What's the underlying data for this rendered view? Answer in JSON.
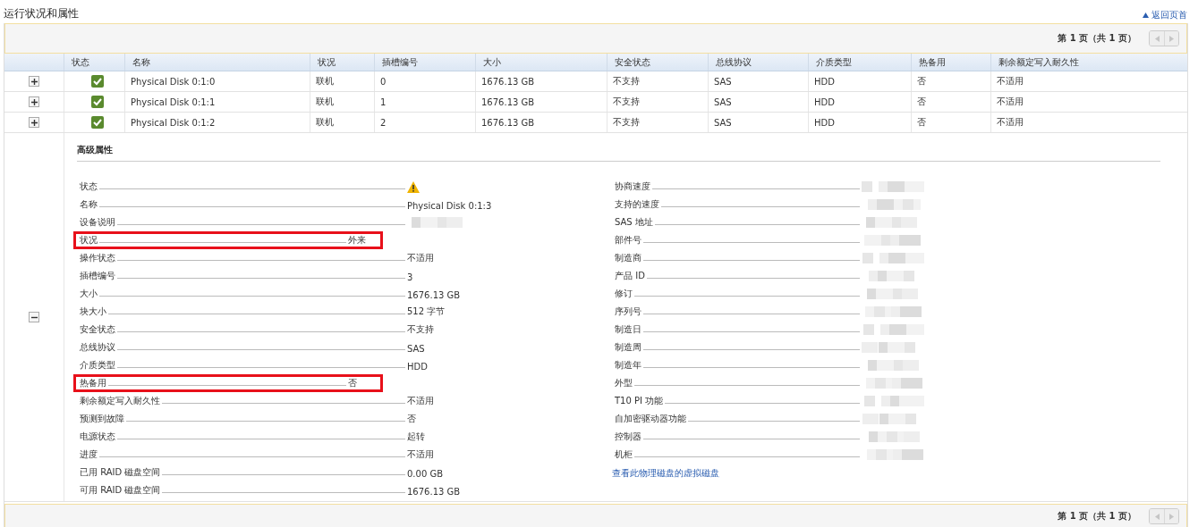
{
  "page_title": "运行状况和属性",
  "back_to_top": {
    "label": "返回页首"
  },
  "pager_top": {
    "label": "第 1 页（共 1 页）",
    "prev_disabled": true,
    "next_disabled": true
  },
  "table": {
    "columns": [
      "状态",
      "名称",
      "状况",
      "插槽编号",
      "大小",
      "安全状态",
      "总线协议",
      "介质类型",
      "热备用",
      "剩余额定写入耐久性"
    ],
    "rows": [
      {
        "expanded": false,
        "warning": false,
        "cells": [
          "Physical Disk 0:1:0",
          "联机",
          "0",
          "1676.13 GB",
          "不支持",
          "SAS",
          "HDD",
          "否",
          "不适用"
        ]
      },
      {
        "expanded": false,
        "warning": false,
        "cells": [
          "Physical Disk 0:1:1",
          "联机",
          "1",
          "1676.13 GB",
          "不支持",
          "SAS",
          "HDD",
          "否",
          "不适用"
        ]
      },
      {
        "expanded": false,
        "warning": false,
        "cells": [
          "Physical Disk 0:1:2",
          "联机",
          "2",
          "1676.13 GB",
          "不支持",
          "SAS",
          "HDD",
          "否",
          "不适用"
        ]
      },
      {
        "expanded": true,
        "details": {
          "title": "高级属性",
          "left": [
            {
              "label": "状态",
              "kind": "status",
              "warning": true,
              "highlighted": false
            },
            {
              "label": "名称",
              "kind": "text",
              "value": "Physical Disk 0:1:3",
              "highlighted": false
            },
            {
              "label": "设备说明",
              "kind": "redacted",
              "highlighted": false
            },
            {
              "label": "状况",
              "kind": "text",
              "value": "外来",
              "highlighted": true
            },
            {
              "label": "操作状态",
              "kind": "text",
              "value": "不适用",
              "highlighted": false
            },
            {
              "label": "插槽编号",
              "kind": "text",
              "value": "3",
              "highlighted": false
            },
            {
              "label": "大小",
              "kind": "text",
              "value": "1676.13 GB",
              "highlighted": false
            },
            {
              "label": "块大小",
              "kind": "text",
              "value": "512 字节",
              "highlighted": false
            },
            {
              "label": "安全状态",
              "kind": "text",
              "value": "不支持",
              "highlighted": false
            },
            {
              "label": "总线协议",
              "kind": "text",
              "value": "SAS",
              "highlighted": false
            },
            {
              "label": "介质类型",
              "kind": "text",
              "value": "HDD",
              "highlighted": false
            },
            {
              "label": "热备用",
              "kind": "text",
              "value": "否",
              "highlighted": true
            },
            {
              "label": "剩余额定写入耐久性",
              "kind": "text",
              "value": "不适用",
              "highlighted": false
            },
            {
              "label": "预测到故障",
              "kind": "text",
              "value": "否",
              "highlighted": false
            },
            {
              "label": "电源状态",
              "kind": "text",
              "value": "起转",
              "highlighted": false
            },
            {
              "label": "进度",
              "kind": "text",
              "value": "不适用",
              "highlighted": false
            },
            {
              "label": "已用 RAID 磁盘空间",
              "kind": "text",
              "value": "0.00 GB",
              "highlighted": false
            },
            {
              "label": "可用 RAID 磁盘空间",
              "kind": "text",
              "value": "1676.13 GB",
              "highlighted": false
            }
          ],
          "right": [
            {
              "label": "协商速度",
              "kind": "redacted",
              "highlighted": false
            },
            {
              "label": "支持的速度",
              "kind": "redacted",
              "highlighted": false
            },
            {
              "label": "SAS 地址",
              "kind": "redacted",
              "highlighted": false
            },
            {
              "label": "部件号",
              "kind": "redacted",
              "highlighted": false
            },
            {
              "label": "制造商",
              "kind": "redacted",
              "highlighted": false
            },
            {
              "label": "产品 ID",
              "kind": "redacted",
              "highlighted": false
            },
            {
              "label": "修订",
              "kind": "redacted",
              "highlighted": false
            },
            {
              "label": "序列号",
              "kind": "redacted",
              "highlighted": false
            },
            {
              "label": "制造日",
              "kind": "redacted",
              "highlighted": false
            },
            {
              "label": "制造周",
              "kind": "redacted",
              "highlighted": false
            },
            {
              "label": "制造年",
              "kind": "redacted",
              "highlighted": false
            },
            {
              "label": "外型",
              "kind": "redacted",
              "highlighted": false
            },
            {
              "label": "T10 PI 功能",
              "kind": "redacted",
              "highlighted": false
            },
            {
              "label": "自加密驱动器功能",
              "kind": "redacted",
              "highlighted": false
            },
            {
              "label": "控制器",
              "kind": "redacted",
              "highlighted": false
            },
            {
              "label": "机柜",
              "kind": "redacted",
              "highlighted": false
            }
          ],
          "link": "查看此物理磁盘的虚拟磁盘"
        }
      }
    ]
  },
  "pager_bottom": {
    "label": "第 1 页（共 1 页）",
    "prev_disabled": true,
    "next_disabled": true
  }
}
